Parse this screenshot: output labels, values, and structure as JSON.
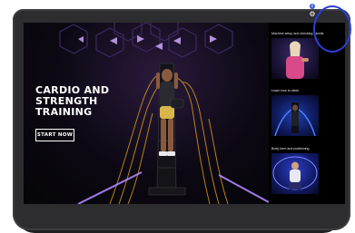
{
  "device": {
    "frame_color": "#2d2d2f"
  },
  "hero": {
    "title_lines": [
      "CARDIO AND",
      "STRENGTH",
      "TRAINING"
    ],
    "start_button_label": "START NOW",
    "accent_color": "#a07cff",
    "wave_color": "#e0a020"
  },
  "sidebar": {
    "videos": [
      {
        "label": "Machine setup and checking tutorial",
        "thumb_icon": "trainer-thumbnail"
      },
      {
        "label": "Learn how to climb",
        "thumb_icon": "climber-thumbnail"
      },
      {
        "label": "Body form and positioning",
        "thumb_icon": "seated-trainer-thumbnail"
      }
    ]
  },
  "top_right_controls": {
    "info_icon": "info-icon",
    "info_glyph": "i",
    "settings_icon": "gear-icon",
    "settings_glyph": "⚙",
    "highlight_color": "#2b3fd4"
  }
}
